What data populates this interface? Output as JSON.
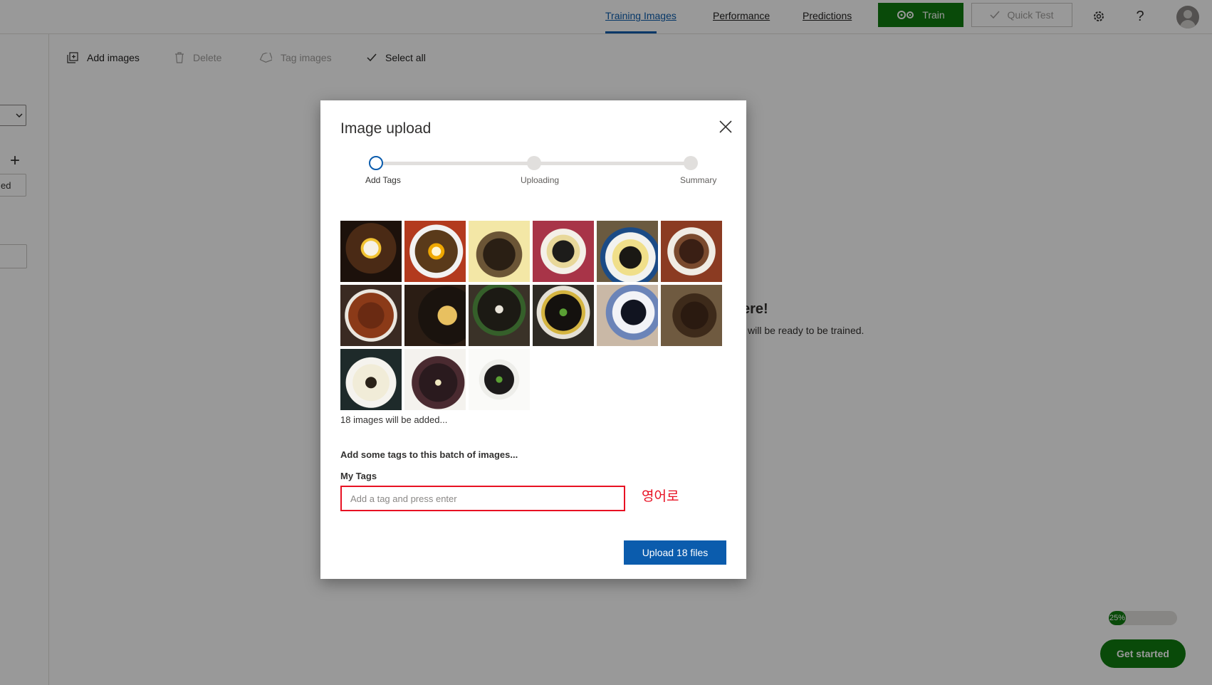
{
  "nav": {
    "tabs": [
      {
        "label": "Training Images",
        "active": true
      },
      {
        "label": "Performance",
        "active": false
      },
      {
        "label": "Predictions",
        "active": false
      }
    ],
    "train_label": "Train",
    "quick_test_label": "Quick Test",
    "settings_icon": "gear-icon",
    "help_label": "?",
    "avatar_icon": "user-avatar"
  },
  "toolbar": {
    "add_images": "Add images",
    "delete": "Delete",
    "tag_images": "Tag images",
    "select_all": "Select all"
  },
  "left_panel": {
    "tag_text": "ed",
    "plus": "+"
  },
  "background": {
    "heading": "ere!",
    "subtext": "will be ready to be trained."
  },
  "onboarding": {
    "progress_label": "25%",
    "progress_value": 0.25,
    "get_started": "Get started"
  },
  "modal": {
    "title": "Image upload",
    "steps": [
      {
        "label": "Add Tags",
        "active": true
      },
      {
        "label": "Uploading",
        "active": false
      },
      {
        "label": "Summary",
        "active": false
      }
    ],
    "thumbnails": [
      "jjajangmyeon-image-1",
      "jjajangmyeon-image-2",
      "jjajangmyeon-image-3",
      "jjajangmyeon-image-4",
      "jjajangmyeon-image-5",
      "jjajangmyeon-image-6",
      "jjajangmyeon-image-7",
      "jjajangmyeon-image-8",
      "jjajangmyeon-image-9",
      "jjajangmyeon-image-10",
      "jjajangmyeon-image-11",
      "jjajangmyeon-image-12",
      "jjajangmyeon-image-13",
      "jjajangmyeon-image-14",
      "jjajangmyeon-image-15"
    ],
    "count_text": "18 images will be added...",
    "batch_heading": "Add some tags to this batch of images...",
    "my_tags_label": "My Tags",
    "tag_placeholder": "Add a tag and press enter",
    "annotation": "영어로",
    "upload_label": "Upload 18 files"
  },
  "colors": {
    "brand_green": "#107c10",
    "accent_blue": "#0b5cad",
    "annotation_red": "#e81123"
  }
}
